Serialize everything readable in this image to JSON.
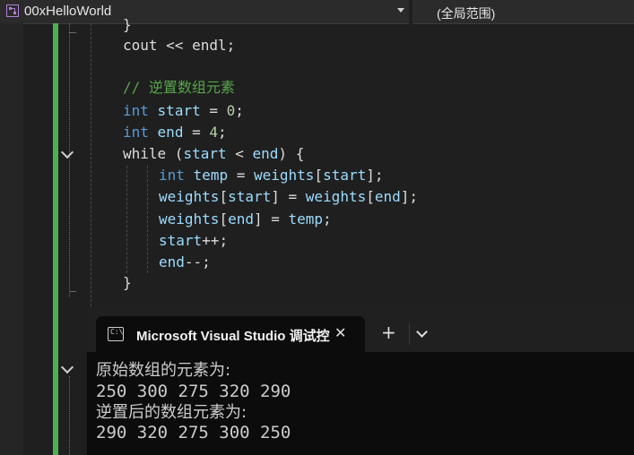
{
  "toolbar": {
    "project_name": "00xHelloWorld",
    "scope_label": "(全局范围)"
  },
  "code": {
    "close_brace_top": "}",
    "line_cout": [
      "cout",
      " << ",
      "endl",
      ";"
    ],
    "comment": "// 逆置数组元素",
    "line_start": [
      "int",
      " ",
      "start",
      " = ",
      "0",
      ";"
    ],
    "line_end": [
      "int",
      " ",
      "end",
      " = ",
      "4",
      ";"
    ],
    "line_while": [
      "while",
      " (",
      "start",
      " < ",
      "end",
      ") {"
    ],
    "line_temp": [
      "int",
      " ",
      "temp",
      " = ",
      "weights",
      "[",
      "start",
      "];"
    ],
    "line_w1": [
      "weights",
      "[",
      "start",
      "] = ",
      "weights",
      "[",
      "end",
      "];"
    ],
    "line_w2": [
      "weights",
      "[",
      "end",
      "] = ",
      "temp",
      ";"
    ],
    "line_inc": [
      "start",
      "++;"
    ],
    "line_dec": [
      "end",
      "--;"
    ],
    "close_brace": "}"
  },
  "console": {
    "tab_title": "Microsoft Visual Studio 调试控",
    "icon_text": "C:\\",
    "close_glyph": "✕",
    "add_glyph": "+",
    "output": [
      "原始数组的元素为:",
      "250 300 275 320 290",
      "逆置后的数组元素为:",
      "290 320 275 300 250"
    ]
  },
  "colors": {
    "keyword": "#569cd6",
    "comment": "#57a64a",
    "variable": "#9cdcfe",
    "number": "#b5cea8",
    "change_bar": "#4caf50"
  }
}
